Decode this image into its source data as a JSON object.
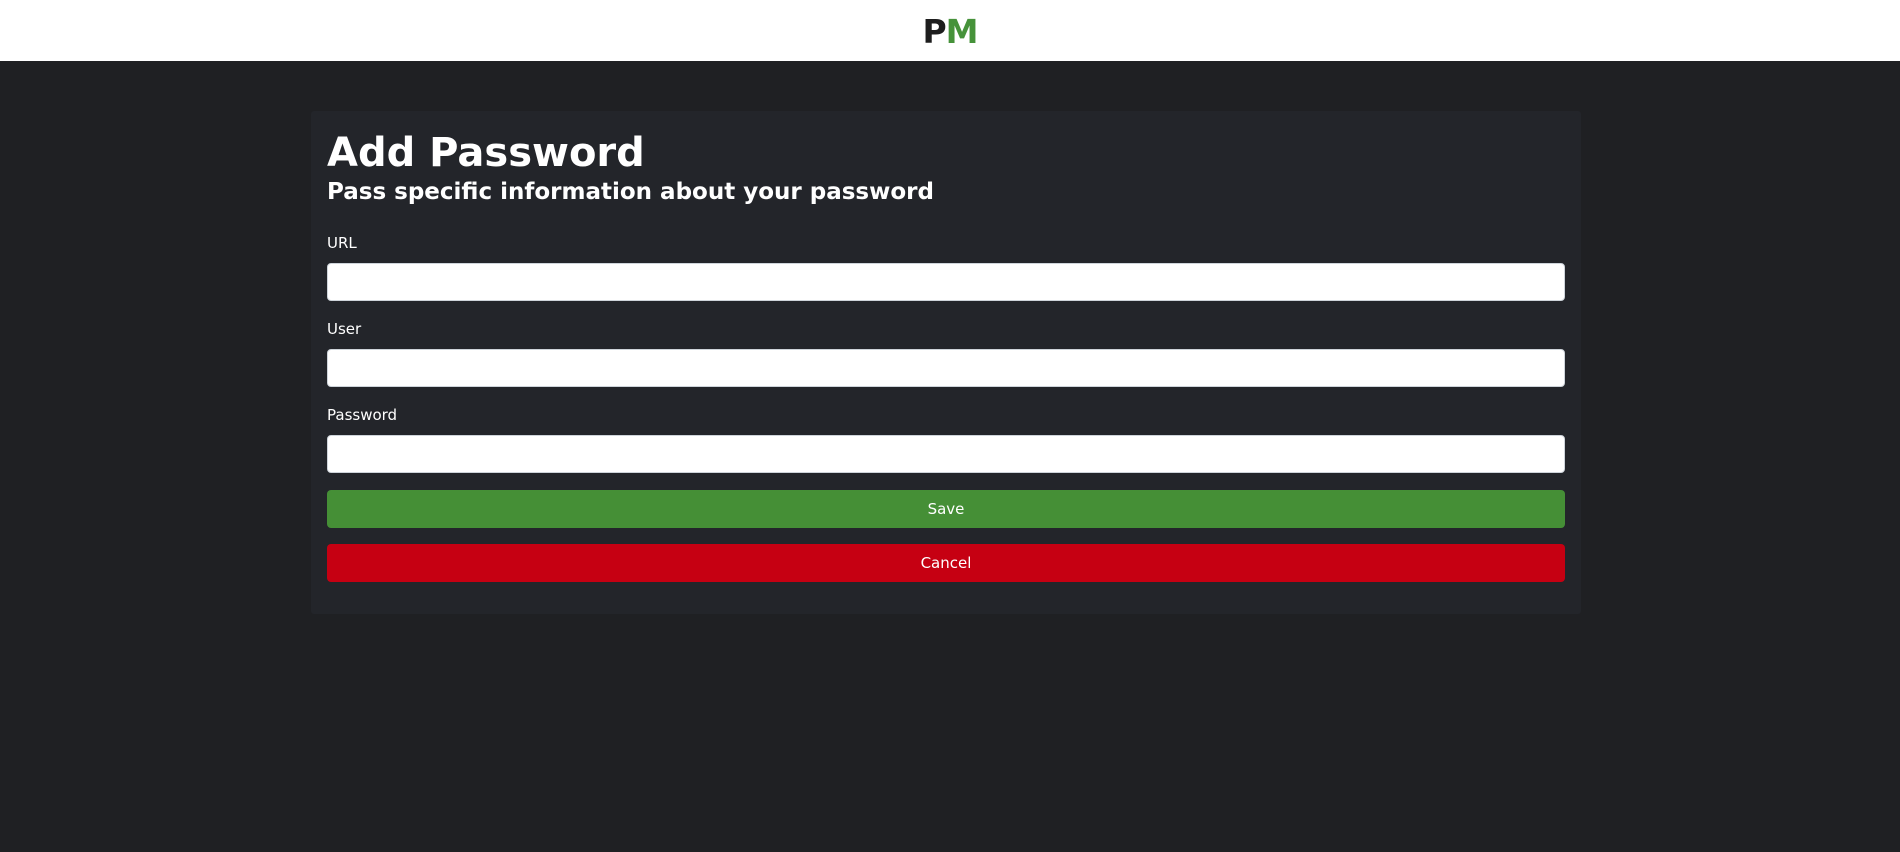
{
  "header": {
    "logo_letter_1": "P",
    "logo_letter_2": "M",
    "logo_color_dark": "#1d1d1d",
    "logo_color_accent": "#46923a"
  },
  "form": {
    "title": "Add Password",
    "subtitle": "Pass specific information about your password",
    "fields": [
      {
        "label": "URL",
        "value": "",
        "placeholder": ""
      },
      {
        "label": "User",
        "value": "",
        "placeholder": ""
      },
      {
        "label": "Password",
        "value": "",
        "placeholder": ""
      }
    ],
    "save_label": "Save",
    "cancel_label": "Cancel",
    "save_color": "#458f36",
    "cancel_color": "#c60012"
  },
  "theme": {
    "page_background": "#1f2023",
    "card_background": "#23252a",
    "header_background": "#ffffff"
  }
}
